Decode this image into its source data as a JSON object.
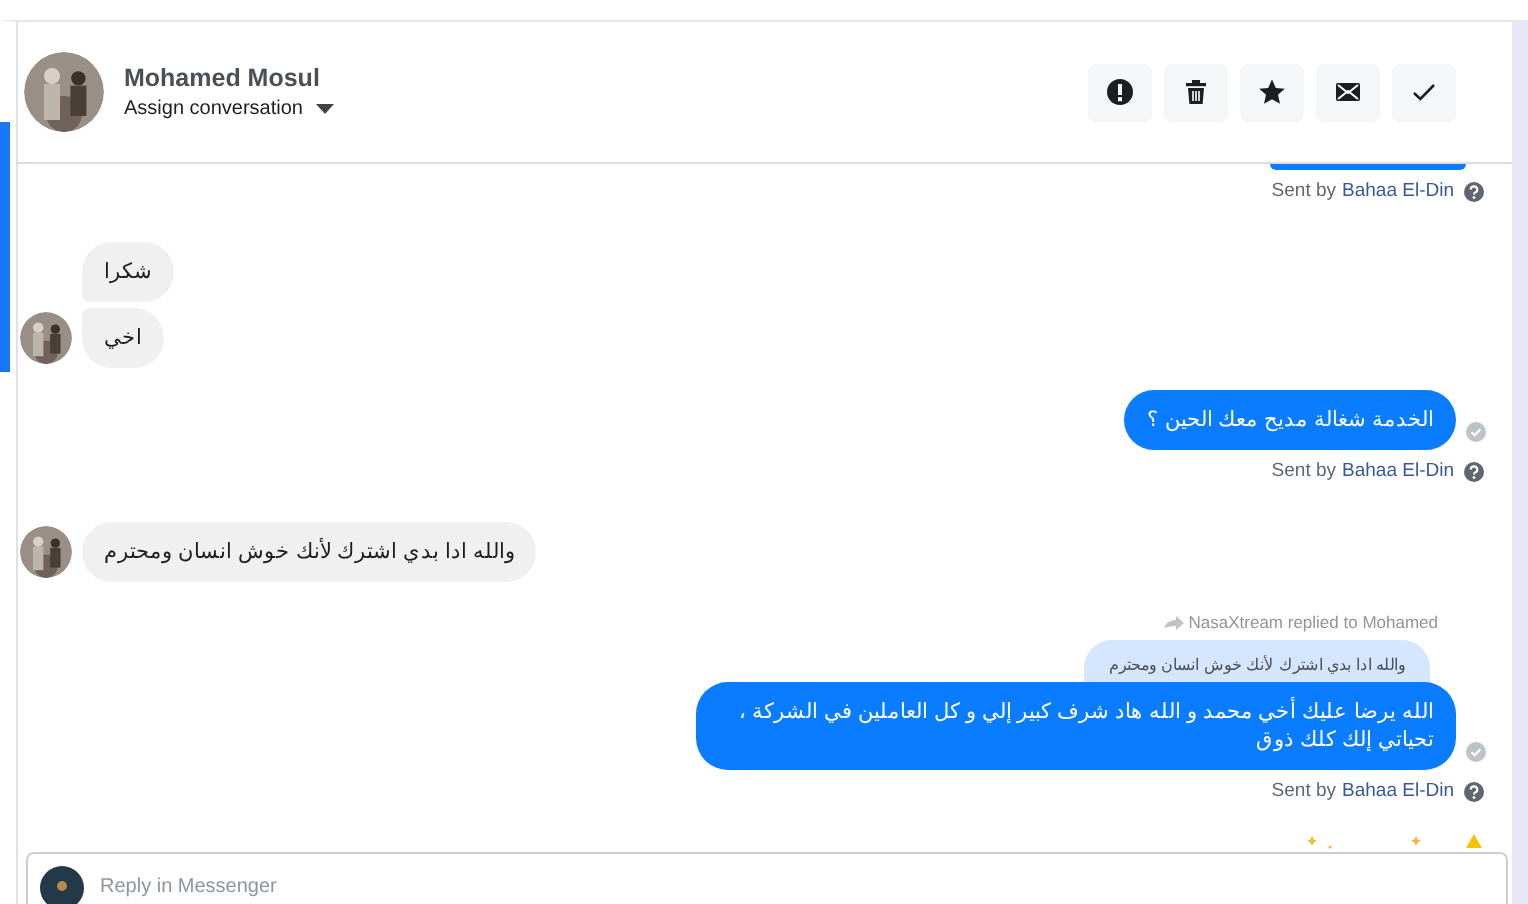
{
  "header": {
    "name": "Mohamed Mosul",
    "assign_label": "Assign conversation"
  },
  "actions": [
    {
      "kind": "alert"
    },
    {
      "kind": "trash"
    },
    {
      "kind": "star"
    },
    {
      "kind": "mail"
    },
    {
      "kind": "check"
    }
  ],
  "messages": [
    {
      "kind": "outgoing_cut",
      "sent_label": "Sent by",
      "agent": "Bahaa El-Din"
    },
    {
      "kind": "incoming",
      "bubbles": [
        "شكرا",
        "اخي"
      ]
    },
    {
      "kind": "outgoing",
      "bubbles": [
        "الخدمة شغالة مديح معك الحين ؟"
      ],
      "sent_label": "Sent by",
      "agent": "Bahaa El-Din"
    },
    {
      "kind": "incoming",
      "bubbles": [
        "والله ادا بدي اشترك لأنك خوش انسان ومحترم"
      ]
    },
    {
      "kind": "outgoing",
      "reply_note": "NasaXtream replied to Mohamed",
      "quoted": "والله ادا بدي اشترك لأنك خوش انسان ومحترم",
      "bubbles": [
        "الله يرضا عليك أخي محمد و الله هاد شرف كبير إلي و كل العاملين في الشركة ، تحياتي إلك كلك ذوق"
      ],
      "sent_label": "Sent by",
      "agent": "Bahaa El-Din"
    }
  ],
  "reply": {
    "placeholder": "Reply in Messenger"
  }
}
